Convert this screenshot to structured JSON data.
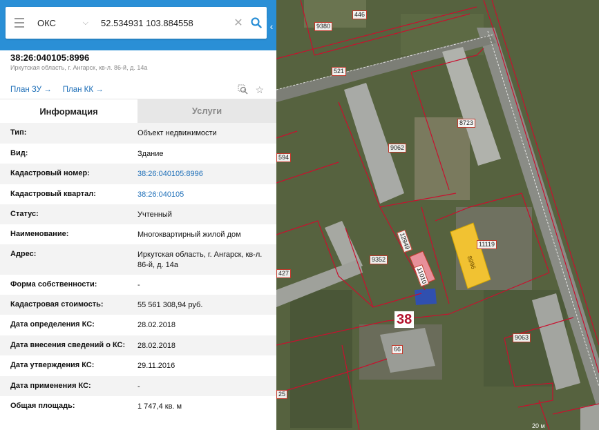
{
  "search": {
    "type_value": "ОКС",
    "coords_value": "52.534931 103.884558"
  },
  "object": {
    "number": "38:26:040105:8996",
    "address_short": "Иркутская область, г. Ангарск, кв-л. 86-й, д. 14а",
    "link_zu": "План ЗУ",
    "link_kk": "План КК"
  },
  "tabs": {
    "info": "Информация",
    "services": "Услуги"
  },
  "rows": [
    {
      "key": "Тип:",
      "value": "Объект недвижимости"
    },
    {
      "key": "Вид:",
      "value": "Здание"
    },
    {
      "key": "Кадастровый номер:",
      "value": "38:26:040105:8996"
    },
    {
      "key": "Кадастровый квартал:",
      "value": "38:26:040105"
    },
    {
      "key": "Статус:",
      "value": "Учтенный"
    },
    {
      "key": "Наименование:",
      "value": "Многоквартирный жилой дом"
    },
    {
      "key": "Адрес:",
      "value": "Иркутская область, г. Ангарск, кв-л. 86-й, д. 14а"
    },
    {
      "key": "Форма собственности:",
      "value": "-"
    },
    {
      "key": "Кадастровая стоимость:",
      "value": "55 561 308,94 руб."
    },
    {
      "key": "Дата определения КС:",
      "value": "28.02.2018"
    },
    {
      "key": "Дата внесения сведений о КС:",
      "value": "28.02.2018"
    },
    {
      "key": "Дата утверждения КС:",
      "value": "29.11.2016"
    },
    {
      "key": "Дата применения КС:",
      "value": "-"
    },
    {
      "key": "Общая площадь:",
      "value": "1 747,4 кв. м"
    }
  ],
  "map": {
    "labels": [
      "446",
      "9380",
      "521",
      "9062",
      "8723",
      "594",
      "11119",
      "8996",
      "9352",
      "427",
      "11010",
      "12949",
      "9063",
      "66",
      "25"
    ],
    "quarter": "38",
    "scale": "20 м"
  },
  "colors": {
    "accent": "#2a8fd6",
    "link": "#1e6fb8",
    "boundary": "#c0392b",
    "selected_building": "#f1c232"
  }
}
